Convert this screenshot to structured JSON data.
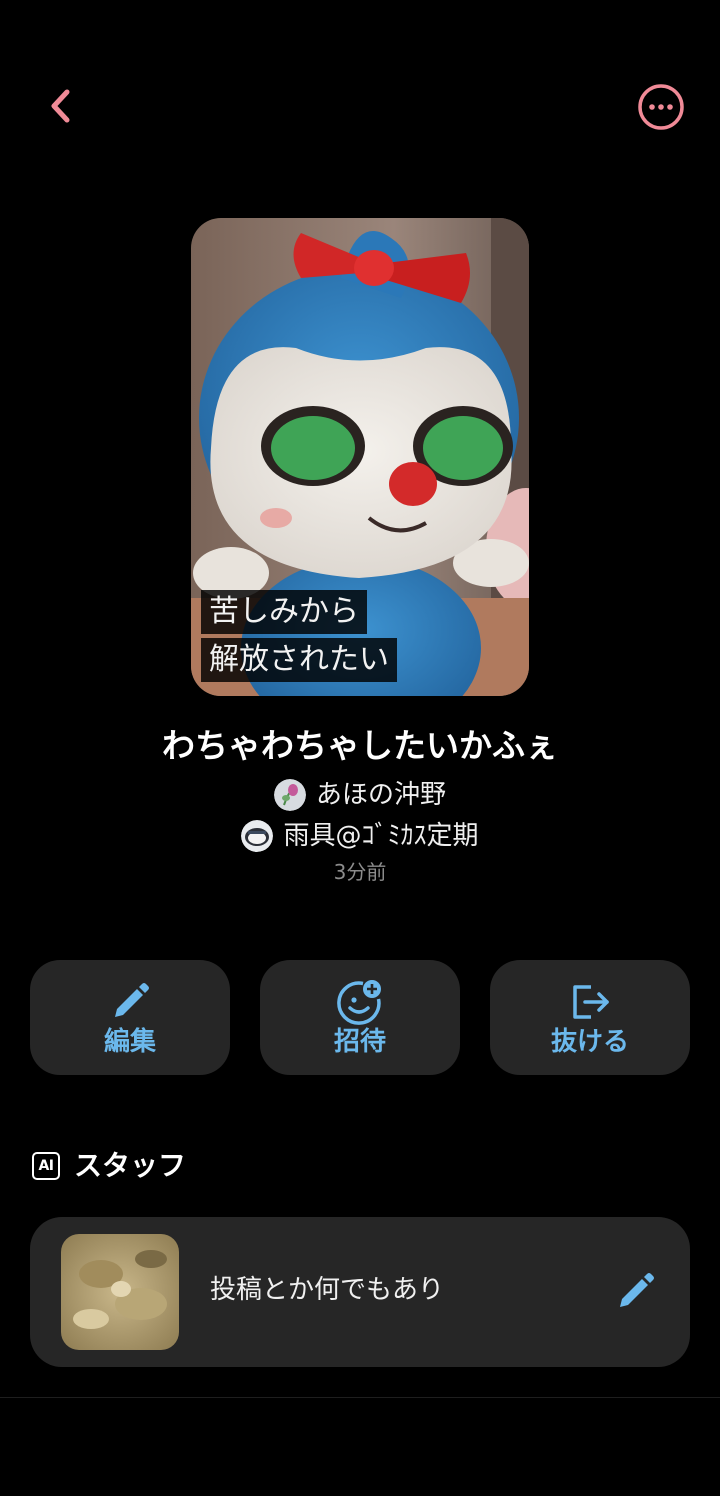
{
  "header": {
    "back_icon": "chevron-left-icon",
    "more_icon": "more-horizontal-circle-icon",
    "accent_color": "#f08a97"
  },
  "cover": {
    "caption_line1": "苦しみから",
    "caption_line2": "解放されたい"
  },
  "room": {
    "title": "わちゃわちゃしたいかふぇ",
    "members": [
      {
        "name": "あほの沖野"
      },
      {
        "name": "雨具@ｺﾞﾐｶｽ定期"
      }
    ],
    "updated": "3分前"
  },
  "actions": {
    "edit_label": "編集",
    "invite_label": "招待",
    "leave_label": "抜ける",
    "label_color": "#6bb8ec"
  },
  "staff_section": {
    "badge": "AI",
    "title": "スタッフ",
    "item": {
      "text": "投稿とか何でもあり"
    }
  }
}
